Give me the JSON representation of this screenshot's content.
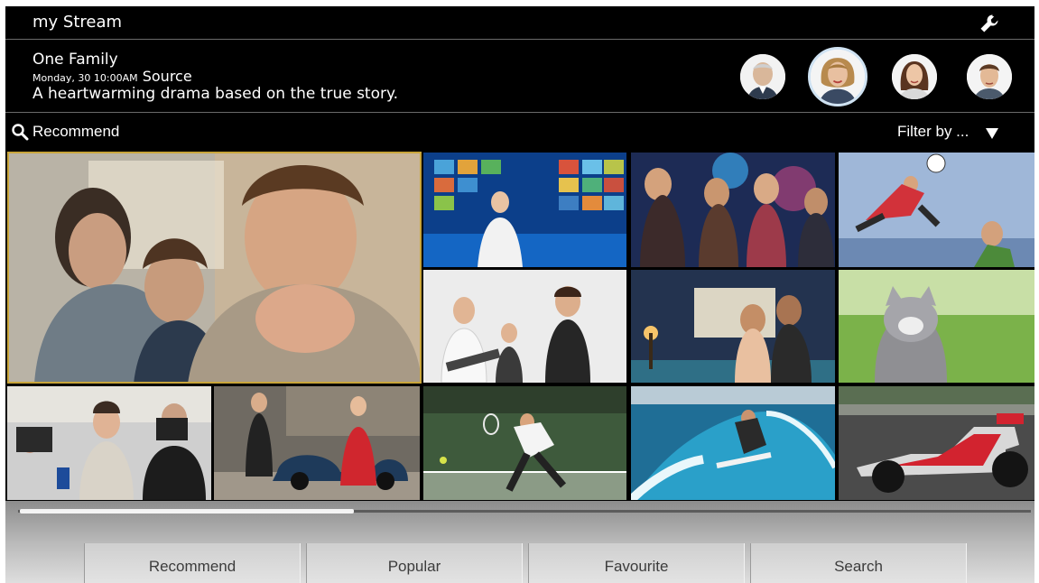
{
  "header": {
    "app_title": "my Stream",
    "settings_icon": "wrench-icon"
  },
  "now_playing": {
    "title": "One Family",
    "day_date": "Monday, 30 10:00AM",
    "source_label": "Source",
    "description": "A heartwarming drama based on the true story."
  },
  "profiles": [
    {
      "name": "profile-elderly-man",
      "selected": false
    },
    {
      "name": "profile-woman",
      "selected": true
    },
    {
      "name": "profile-young-woman",
      "selected": false
    },
    {
      "name": "profile-young-man",
      "selected": false
    }
  ],
  "section": {
    "label": "Recommend",
    "search_icon": "search-icon",
    "filter_label": "Filter by ...",
    "filter_icon": "triangle-down-icon"
  },
  "tiles": [
    "family-drama",
    "news-studio",
    "party-dance",
    "football-action",
    "live-concert",
    "romantic-couple",
    "cat",
    "press-interview",
    "street-fashion",
    "tennis",
    "surfing",
    "formula-racing"
  ],
  "scroll": {
    "position": 0.33
  },
  "tabs": [
    {
      "label": "Recommend"
    },
    {
      "label": "Popular"
    },
    {
      "label": "Favourite"
    },
    {
      "label": "Search"
    }
  ],
  "colors": {
    "background": "#000000",
    "featured_border": "#c9a53a",
    "tab_text": "#3c3c3c"
  }
}
